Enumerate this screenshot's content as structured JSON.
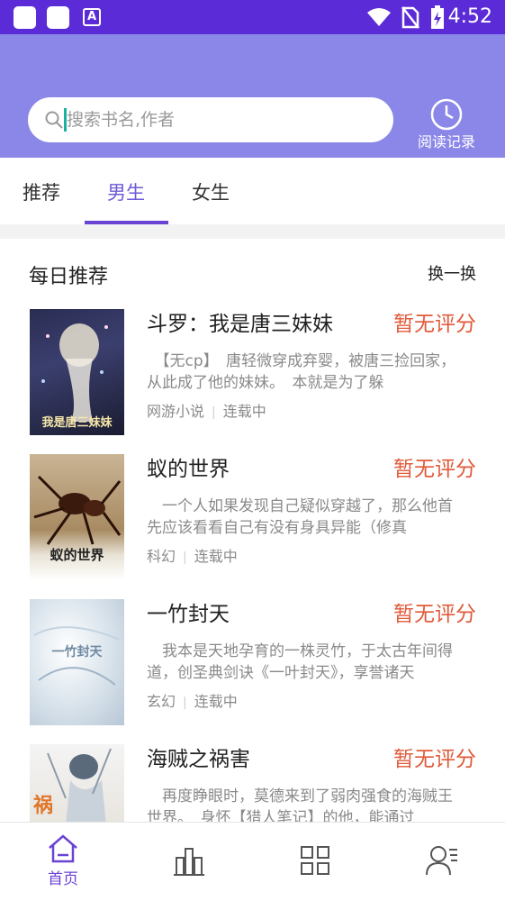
{
  "status_bar": {
    "time": "4:52",
    "notification_icon": "A"
  },
  "header": {
    "search": {
      "placeholder": "搜索书名,作者"
    },
    "history_label": "阅读记录"
  },
  "tabs": [
    {
      "label": "推荐"
    },
    {
      "label": "男生"
    },
    {
      "label": "女生"
    }
  ],
  "active_tab": "男生",
  "section": {
    "title": "每日推荐",
    "refresh_label": "换一换"
  },
  "books": [
    {
      "title": "斗罗：我是唐三妹妹",
      "rating": "暂无评分",
      "desc": "　【无cp】　唐轻微穿成弃婴，被唐三捡回家，从此成了他的妹妹。　本就是为了躲",
      "category": "网游小说",
      "status": "连载中",
      "cover_text": "我是唐三妹妹"
    },
    {
      "title": "蚁的世界",
      "rating": "暂无评分",
      "desc": "　一个人如果发现自己疑似穿越了，那么他首先应该看看自己有没有身具异能（修真",
      "category": "科幻",
      "status": "连载中",
      "cover_text": "蚁的世界"
    },
    {
      "title": "一竹封天",
      "rating": "暂无评分",
      "desc": "　我本是天地孕育的一株灵竹，于太古年间得道，创圣典剑诀《一叶封天》，享誉诸天",
      "category": "玄幻",
      "status": "连载中",
      "cover_text": "一竹封天"
    },
    {
      "title": "海贼之祸害",
      "rating": "暂无评分",
      "desc": "　再度睁眼时，莫德来到了弱肉强食的海贼王世界。　身怀【猎人笔记】的他，能通过",
      "category": "",
      "status": "",
      "cover_text": "祸"
    }
  ],
  "bottom_nav": [
    {
      "label": "首页",
      "icon": "home-icon",
      "active": true
    },
    {
      "label": "",
      "icon": "bookshelf-icon",
      "active": false
    },
    {
      "label": "",
      "icon": "category-icon",
      "active": false
    },
    {
      "label": "",
      "icon": "profile-icon",
      "active": false
    }
  ],
  "colors": {
    "status_bar": "#5a2bd6",
    "header": "#8b87e8",
    "accent": "#6a43d4",
    "rating": "#e05a3a"
  }
}
